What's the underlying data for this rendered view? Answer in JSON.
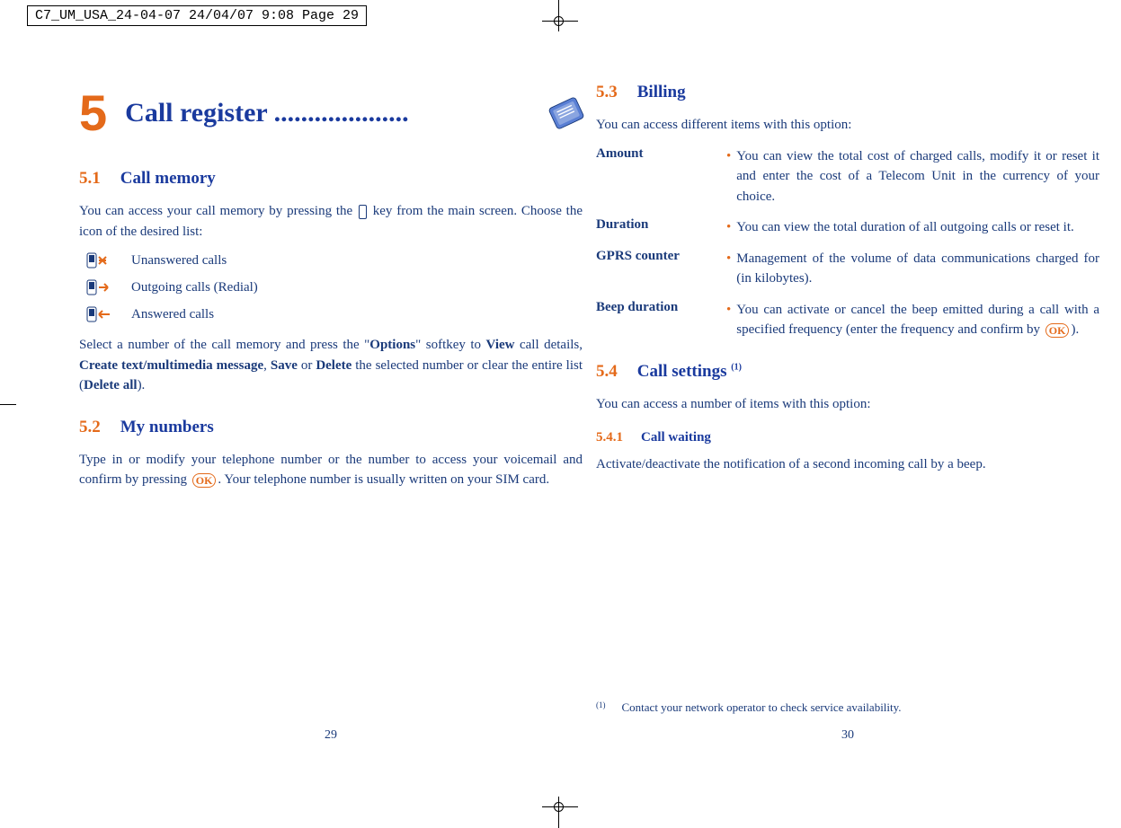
{
  "header_slug": "C7_UM_USA_24-04-07  24/04/07  9:08  Page 29",
  "chapter": {
    "number": "5",
    "title": "Call register ....................",
    "icon_name": "phone-log-icon"
  },
  "left": {
    "s51_num": "5.1",
    "s51_title": "Call memory",
    "s51_p1a": "You can access your call memory by pressing the ",
    "s51_p1b": " key from the main screen. Choose the icon of the desired list:",
    "list": {
      "unanswered": "Unanswered calls",
      "outgoing": "Outgoing calls (Redial)",
      "answered": "Answered calls"
    },
    "s51_p2_parts": {
      "a": "Select a number of the call memory and press the \"",
      "b": "Options",
      "c": "\" softkey to ",
      "d": "View",
      "e": " call details, ",
      "f": "Create text/multimedia message",
      "g": ", ",
      "h": "Save",
      "i": " or ",
      "j": "Delete",
      "k": " the selected number or clear the entire list (",
      "l": "Delete all",
      "m": ")."
    },
    "s52_num": "5.2",
    "s52_title": "My numbers",
    "s52_p1a": "Type in or modify your telephone number or the number to access your voicemail and confirm by pressing ",
    "s52_p1b": ". Your telephone number is usually written on your SIM card.",
    "pagenum": "29"
  },
  "right": {
    "s53_num": "5.3",
    "s53_title": "Billing",
    "s53_intro": "You can access different items with this option:",
    "defs": {
      "amount_t": "Amount",
      "amount_d": "You can view the total cost of charged calls, modify it or reset it and enter the cost of a Telecom Unit in the currency of your choice.",
      "duration_t": "Duration",
      "duration_d": "You can view the total duration of all outgoing calls or reset it.",
      "gprs_t": "GPRS counter",
      "gprs_d": "Management of the volume of data communications charged for (in kilobytes).",
      "beep_t": "Beep duration",
      "beep_d_a": "You can activate or cancel the beep emitted during a call with a specified frequency (enter the frequency and confirm by ",
      "beep_d_b": ")."
    },
    "s54_num": "5.4",
    "s54_title": "Call settings ",
    "s54_sup": "(1)",
    "s54_intro": "You can access a number of items with this option:",
    "s541_num": "5.4.1",
    "s541_title": "Call waiting",
    "s541_p": "Activate/deactivate the notification of a second incoming call by a beep.",
    "footnote_sup": "(1)",
    "footnote": "Contact your network operator to check service availability.",
    "pagenum": "30"
  },
  "ok_label": "OK"
}
